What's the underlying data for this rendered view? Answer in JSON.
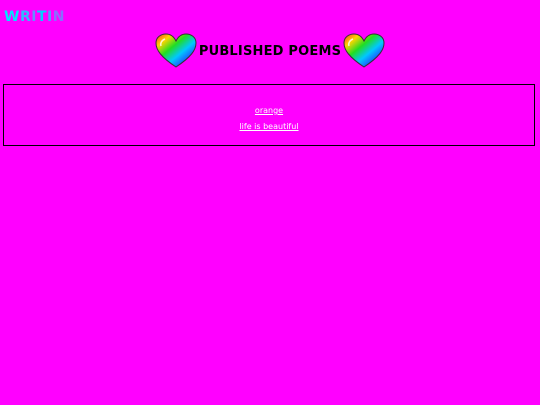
{
  "site": {
    "logo_letters": [
      {
        "char": "W",
        "color": "#00e5ff"
      },
      {
        "char": "R",
        "color": "#33b8ff"
      },
      {
        "char": "I",
        "color": "#668cff"
      },
      {
        "char": "T",
        "color": "#00d0ff"
      },
      {
        "char": "I",
        "color": "#4aa0ff"
      },
      {
        "char": "N",
        "color": "#8a6cff"
      }
    ]
  },
  "header": {
    "title": "PUBLISHED POEMS",
    "left_icon": "rainbow-heart-icon",
    "right_icon": "rainbow-heart-icon"
  },
  "poems": [
    {
      "title": "orange"
    },
    {
      "title": "life is beautiful"
    }
  ],
  "colors": {
    "background": "#ff00ff",
    "link": "#ffffff",
    "border": "#000000"
  }
}
